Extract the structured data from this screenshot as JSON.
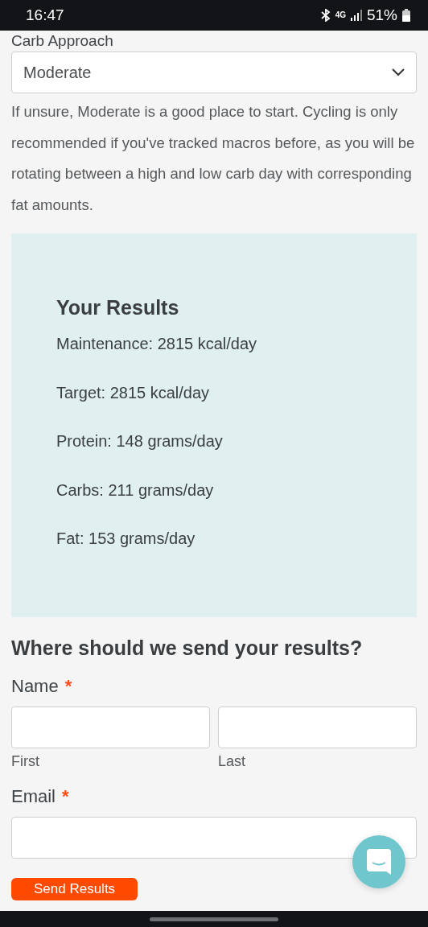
{
  "status_bar": {
    "time": "16:47",
    "network": "4G",
    "battery": "51%"
  },
  "carb_approach": {
    "label": "Carb Approach",
    "value": "Moderate",
    "hint": "If unsure, Moderate is a good place to start. Cycling is only recommended if you've tracked macros before, as you will be rotating between a high and low carb day with corresponding fat amounts."
  },
  "results": {
    "title": "Your Results",
    "lines": [
      "Maintenance: 2815 kcal/day",
      "Target: 2815 kcal/day",
      "Protein: 148 grams/day",
      "Carbs: 211 grams/day",
      "Fat: 153 grams/day"
    ]
  },
  "form": {
    "title": "Where should we send your results?",
    "name": {
      "label": "Name",
      "required_mark": "*",
      "fields": [
        {
          "sublabel": "First"
        },
        {
          "sublabel": "Last"
        }
      ]
    },
    "email": {
      "label": "Email",
      "required_mark": "*"
    },
    "submit": "Send Results"
  }
}
